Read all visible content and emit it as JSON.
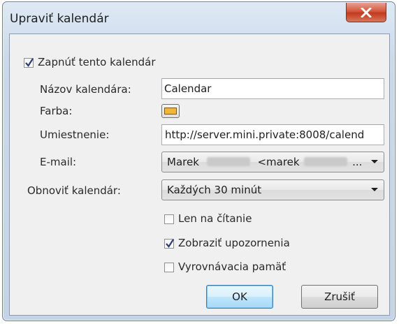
{
  "dialog": {
    "title": "Upraviť kalendár"
  },
  "enable_checkbox": {
    "label": "Zapnúť tento kalendár",
    "checked": true
  },
  "fields": {
    "name_label": "Názov kalendára:",
    "name_value": "Calendar",
    "color_label": "Farba:",
    "color_value": "#f3b63d",
    "location_label": "Umiestnenie:",
    "location_value": "http://server.mini.private:8008/calend",
    "email_label": "E-mail:",
    "email_value_start": "Marek",
    "email_value_mid": "<marek",
    "email_value_end": "...",
    "refresh_label": "Obnoviť kalendár:",
    "refresh_value": "Každých 30 minút"
  },
  "options": {
    "read_only_label": "Len na čítanie",
    "read_only_checked": false,
    "show_alarms_label": "Zobraziť upozornenia",
    "show_alarms_checked": true,
    "cache_label": "Vyrovnávacia pamäť",
    "cache_checked": false
  },
  "buttons": {
    "ok": "OK",
    "cancel": "Zrušiť"
  },
  "icons": {
    "close": "close-icon",
    "checkmark": "checkmark-icon",
    "dropdown": "chevron-down-icon"
  }
}
